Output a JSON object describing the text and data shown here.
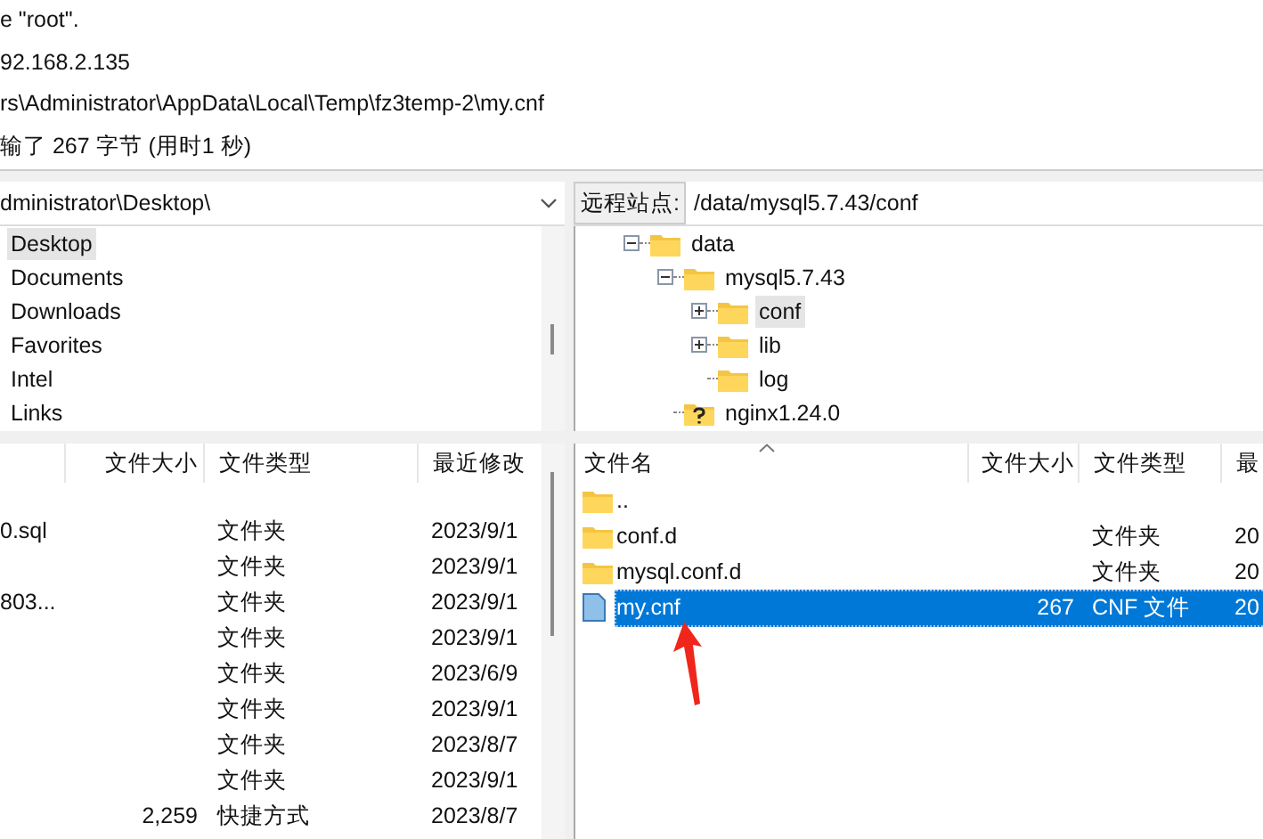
{
  "log": [
    "e \"root\".",
    "92.168.2.135",
    "rs\\Administrator\\AppData\\Local\\Temp\\fz3temp-2\\my.cnf",
    "输了 267 字节 (用时1 秒)"
  ],
  "local": {
    "path": "dministrator\\Desktop\\",
    "tree": [
      {
        "name": "Desktop",
        "selected": true
      },
      {
        "name": "Documents",
        "selected": false
      },
      {
        "name": "Downloads",
        "selected": false
      },
      {
        "name": "Favorites",
        "selected": false
      },
      {
        "name": "Intel",
        "selected": false
      },
      {
        "name": "Links",
        "selected": false
      }
    ],
    "columns": [
      "文件大小",
      "文件类型",
      "最近修改"
    ],
    "rows": [
      {
        "name": "0.sql",
        "type": "文件夹",
        "modified": "2023/9/1"
      },
      {
        "type": "文件夹",
        "modified": "2023/9/1"
      },
      {
        "name": "803...",
        "type": "文件夹",
        "modified": "2023/9/1"
      },
      {
        "type": "文件夹",
        "modified": "2023/9/1"
      },
      {
        "type": "文件夹",
        "modified": "2023/6/9"
      },
      {
        "type": "文件夹",
        "modified": "2023/9/1"
      },
      {
        "type": "文件夹",
        "modified": "2023/8/7"
      },
      {
        "type": "文件夹",
        "modified": "2023/9/1"
      },
      {
        "size": "2,259",
        "type": "快捷方式",
        "modified": "2023/8/7"
      }
    ]
  },
  "remote": {
    "label": "远程站点:",
    "path": "/data/mysql5.7.43/conf",
    "tree": [
      {
        "name": "data",
        "kind": "folder",
        "expandable": true,
        "expanded": true,
        "selected": false,
        "children": [
          {
            "name": "mysql5.7.43",
            "kind": "folder",
            "expandable": true,
            "expanded": true,
            "selected": false,
            "children": [
              {
                "name": "conf",
                "kind": "folder",
                "expandable": true,
                "expanded": false,
                "selected": true
              },
              {
                "name": "lib",
                "kind": "folder",
                "expandable": true,
                "expanded": false,
                "selected": false
              },
              {
                "name": "log",
                "kind": "folder",
                "expandable": false,
                "expanded": false,
                "selected": false
              }
            ]
          },
          {
            "name": "nginx1.24.0",
            "kind": "unknown",
            "expandable": false,
            "expanded": false,
            "selected": false
          }
        ]
      }
    ],
    "columns": [
      "文件名",
      "文件大小",
      "文件类型",
      "最"
    ],
    "files": [
      {
        "name": "..",
        "kind": "folder",
        "selected": false
      },
      {
        "name": "conf.d",
        "kind": "folder",
        "type": "文件夹",
        "modified": "20",
        "selected": false
      },
      {
        "name": "mysql.conf.d",
        "kind": "folder",
        "type": "文件夹",
        "modified": "20",
        "selected": false
      },
      {
        "name": "my.cnf",
        "kind": "file",
        "size": "267",
        "type": "CNF 文件",
        "modified": "20",
        "selected": true
      }
    ]
  }
}
